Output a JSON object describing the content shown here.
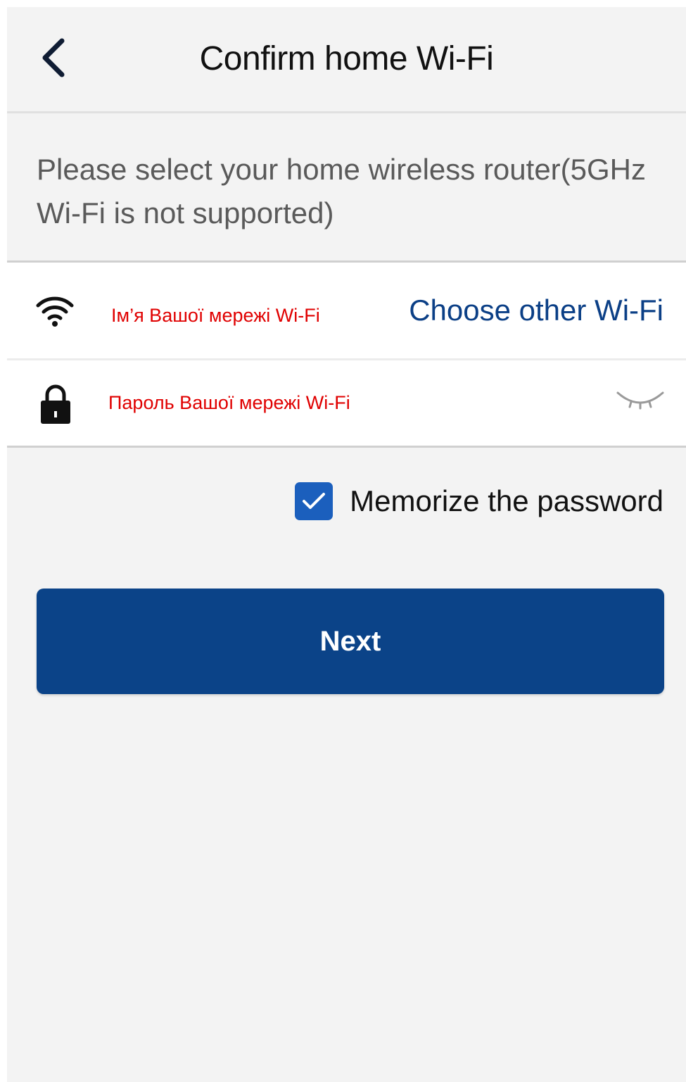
{
  "header": {
    "title": "Confirm home Wi-Fi",
    "back_icon": "chevron-left-icon"
  },
  "hint": {
    "text": "Please select your home wireless router(5GHz Wi-Fi is not supported)"
  },
  "wifi_row": {
    "icon": "wifi-icon",
    "network_name": "Ім’я Вашої мережі Wi-Fi",
    "choose_other_label": "Choose other Wi-Fi"
  },
  "password_row": {
    "icon": "lock-icon",
    "placeholder": "Пароль Вашої мережі Wi-Fi",
    "value": "",
    "toggle_icon": "eye-closed-icon"
  },
  "memorize": {
    "label": "Memorize the password",
    "checked": true
  },
  "next_button": {
    "label": "Next"
  },
  "colors": {
    "background": "#f3f3f3",
    "primary_button": "#0b4388",
    "link": "#0b3f86",
    "checkbox": "#1b5fbd",
    "annotation_red": "#e00000"
  }
}
